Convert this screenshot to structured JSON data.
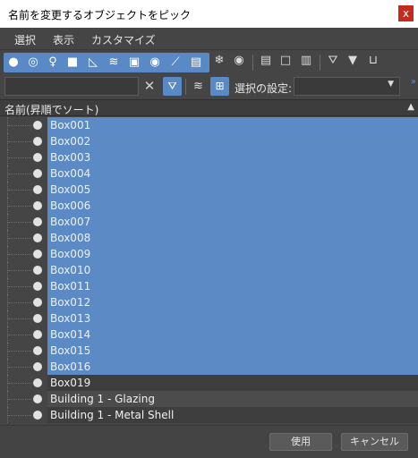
{
  "window": {
    "title": "名前を変更するオブジェクトをピック",
    "close_glyph": "x"
  },
  "menu": [
    "選択",
    "表示",
    "カスタマイズ"
  ],
  "toolbar": {
    "type_icons": [
      "geometry-icon",
      "shapes-icon",
      "lights-icon",
      "cameras-icon",
      "helpers-icon",
      "space-warps-icon",
      "groups-icon",
      "xrefs-icon",
      "bones-icon",
      "containers-icon"
    ],
    "other_icons": [
      "frozen-icon",
      "hidden-icon",
      "select-all-icon",
      "select-none-icon",
      "invert-icon",
      "filter-icon",
      "filter-funnel-icon",
      "display-children-icon"
    ]
  },
  "filter": {
    "value": "",
    "selection_set_label": "選択の設定:",
    "selection_set_value": ""
  },
  "list": {
    "header": "名前(昇順でソート)",
    "sort_glyph": "▲",
    "items": [
      {
        "name": "Box001",
        "selected": true
      },
      {
        "name": "Box002",
        "selected": true
      },
      {
        "name": "Box003",
        "selected": true
      },
      {
        "name": "Box004",
        "selected": true
      },
      {
        "name": "Box005",
        "selected": true
      },
      {
        "name": "Box006",
        "selected": true
      },
      {
        "name": "Box007",
        "selected": true
      },
      {
        "name": "Box008",
        "selected": true
      },
      {
        "name": "Box009",
        "selected": true
      },
      {
        "name": "Box010",
        "selected": true
      },
      {
        "name": "Box011",
        "selected": true
      },
      {
        "name": "Box012",
        "selected": true
      },
      {
        "name": "Box013",
        "selected": true
      },
      {
        "name": "Box014",
        "selected": true
      },
      {
        "name": "Box015",
        "selected": true
      },
      {
        "name": "Box016",
        "selected": true
      },
      {
        "name": "Box019",
        "selected": false
      },
      {
        "name": "Building 1 - Glazing",
        "selected": false
      },
      {
        "name": "Building 1 - Metal Shell",
        "selected": false
      }
    ]
  },
  "buttons": {
    "ok": "使用",
    "cancel": "キャンセル"
  }
}
